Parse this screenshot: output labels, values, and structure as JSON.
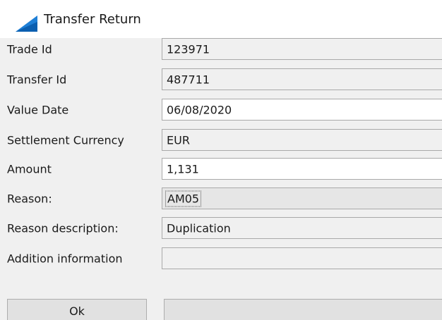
{
  "window": {
    "title": "Transfer Return",
    "icon": "triangle-logo-icon",
    "accent_color": "#1e7fd6"
  },
  "form": {
    "fields": [
      {
        "label": "Trade Id",
        "value": "123971",
        "state": "readonly"
      },
      {
        "label": "Transfer Id",
        "value": "487711",
        "state": "readonly"
      },
      {
        "label": "Value Date",
        "value": "06/08/2020",
        "state": "editable"
      },
      {
        "label": "Settlement Currency",
        "value": "EUR",
        "state": "readonly"
      },
      {
        "label": "Amount",
        "value": "1,131",
        "state": "editable"
      },
      {
        "label": "Reason:",
        "value": "AM05",
        "state": "select-focused"
      },
      {
        "label": "Reason description:",
        "value": "Duplication",
        "state": "readonly"
      },
      {
        "label": "Addition information",
        "value": "",
        "state": "readonly"
      }
    ]
  },
  "buttons": {
    "ok_label": "Ok",
    "second_label": ""
  }
}
